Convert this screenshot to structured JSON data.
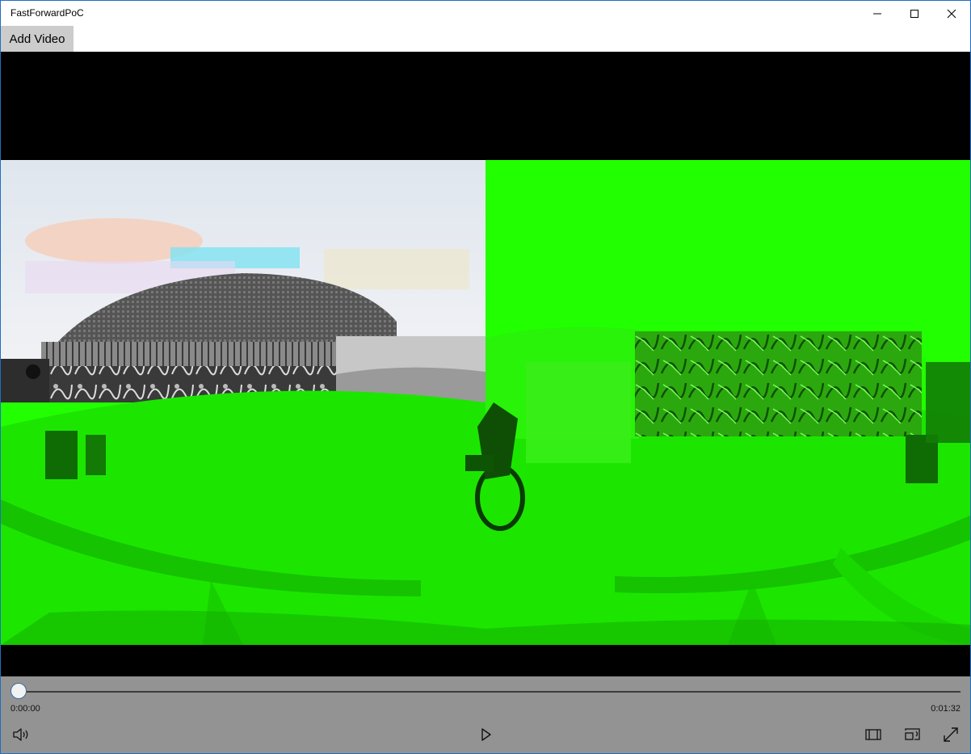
{
  "window": {
    "title": "FastForwardPoC"
  },
  "command_bar": {
    "add_video_label": "Add Video"
  },
  "player": {
    "position_fraction": 0.0,
    "time_elapsed": "0:00:00",
    "time_total": "0:01:32"
  },
  "icons": {
    "minimize": "minimize-icon",
    "maximize": "maximize-icon",
    "close": "close-icon",
    "volume": "volume-icon",
    "play": "play-icon",
    "aspect": "aspect-ratio-icon",
    "cast": "cast-to-device-icon",
    "fullscreen": "fullscreen-icon"
  },
  "colors": {
    "chroma_green": "#22ff00",
    "transport_bg": "#939393",
    "window_border": "#1f6fbf"
  }
}
